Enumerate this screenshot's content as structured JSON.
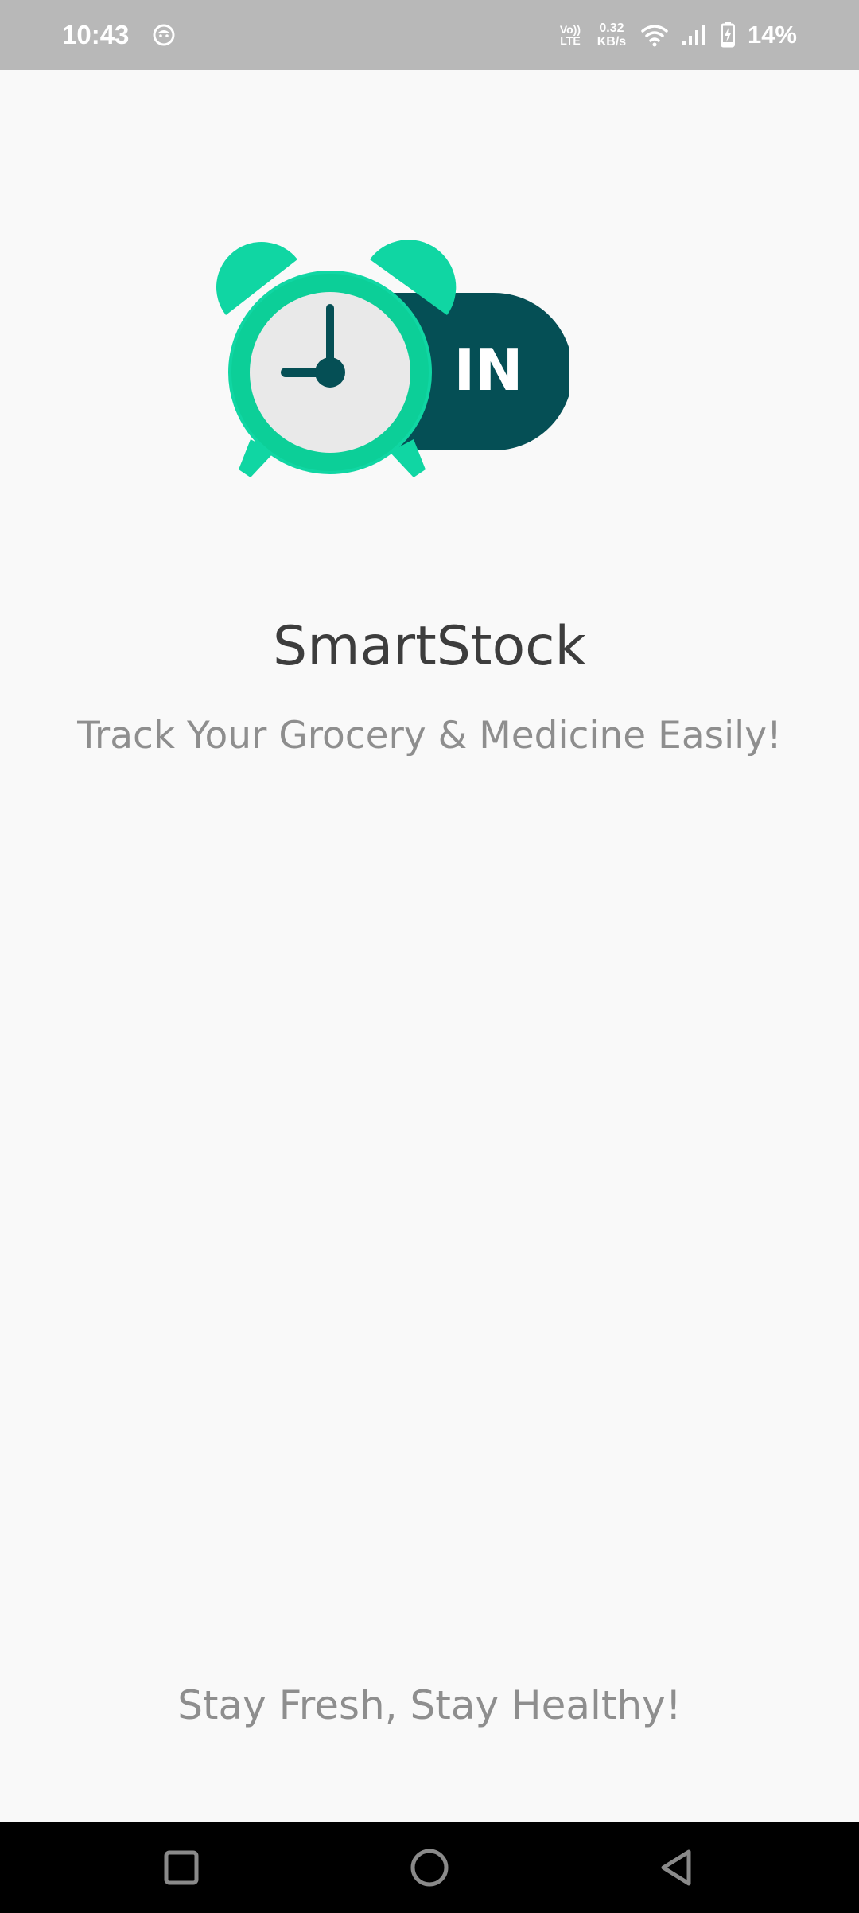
{
  "status_bar": {
    "time": "10:43",
    "notification_icon": "app-notification-icon",
    "volte_line1": "Vo))",
    "volte_line2": "LTE",
    "net_speed_value": "0.32",
    "net_speed_unit": "KB/s",
    "wifi_icon": "wifi-icon",
    "signal_icon": "cell-signal-icon",
    "battery_icon": "battery-charging-icon",
    "battery_percent": "14%"
  },
  "logo": {
    "badge_text": "IN",
    "icon": "alarm-clock-icon",
    "colors": {
      "clock_green": "#10d6a3",
      "clock_ring": "#0ccf98",
      "clock_face": "#e9e9e9",
      "dark_teal": "#054f55"
    }
  },
  "app": {
    "title": "SmartStock",
    "tagline": "Track Your Grocery & Medicine Easily!",
    "footer": "Stay Fresh, Stay Healthy!"
  },
  "nav_bar": {
    "recents_icon": "recents-square-icon",
    "home_icon": "home-circle-icon",
    "back_icon": "back-triangle-icon"
  }
}
